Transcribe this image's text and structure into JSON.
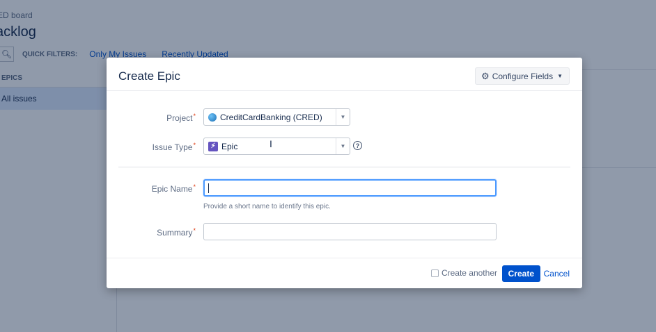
{
  "background": {
    "board_name": "ED board",
    "page_title": "acklog",
    "quick_filters_label": "QUICK FILTERS:",
    "quick_filters": [
      "Only My Issues",
      "Recently Updated"
    ],
    "epics_header": "EPICS",
    "epics_all_issues": "All issues"
  },
  "dialog": {
    "title": "Create Epic",
    "configure_fields": "Configure Fields",
    "fields": {
      "project": {
        "label": "Project",
        "required_mark": "*",
        "value": "CreditCardBanking (CRED)"
      },
      "issue_type": {
        "label": "Issue Type",
        "required_mark": "*",
        "value": "Epic",
        "help": "?"
      },
      "epic_name": {
        "label": "Epic Name",
        "required_mark": "*",
        "value": "",
        "hint": "Provide a short name to identify this epic."
      },
      "summary": {
        "label": "Summary",
        "required_mark": "*",
        "value": ""
      }
    },
    "footer": {
      "create_another": "Create another",
      "create_button": "Create",
      "cancel_link": "Cancel"
    }
  },
  "icons": {
    "search": "search-icon",
    "gear": "gear-icon",
    "dropdown": "chevron-down-icon",
    "project": "project-avatar-icon",
    "epic": "epic-icon",
    "help": "help-icon"
  },
  "colors": {
    "primary": "#0052cc",
    "overlay": "#091e42",
    "epic": "#6554c0",
    "required": "#de350b",
    "focus": "#4c9aff"
  }
}
